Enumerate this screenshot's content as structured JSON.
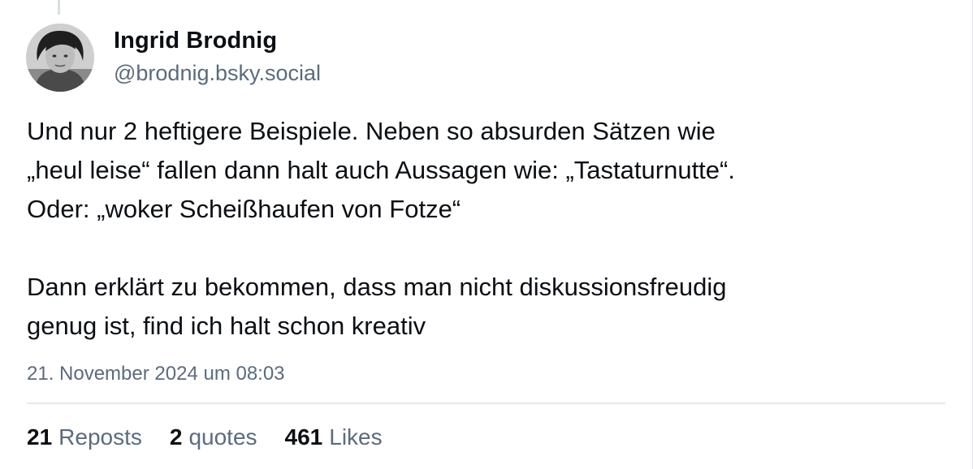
{
  "author": {
    "display_name": "Ingrid Brodnig",
    "handle": "@brodnig.bsky.social"
  },
  "post": {
    "lines": [
      "Und nur 2 heftigere Beispiele. Neben so absurden Sätzen wie",
      "„heul leise“ fallen dann halt auch Aussagen wie: „Tastaturnutte“.",
      "Oder: „woker Scheißhaufen von Fotze“",
      "",
      "Dann erklärt zu bekommen, dass man nicht diskussionsfreudig",
      "genug ist, find ich halt schon kreativ"
    ],
    "timestamp": "21. November 2024 um 08:03"
  },
  "stats": {
    "reposts_count": "21",
    "reposts_label": "Reposts",
    "quotes_count": "2",
    "quotes_label": "quotes",
    "likes_count": "461",
    "likes_label": "Likes"
  },
  "colors": {
    "text_primary": "#0b0f14",
    "text_secondary": "#5b6b7d",
    "divider": "#e6e9ed"
  }
}
